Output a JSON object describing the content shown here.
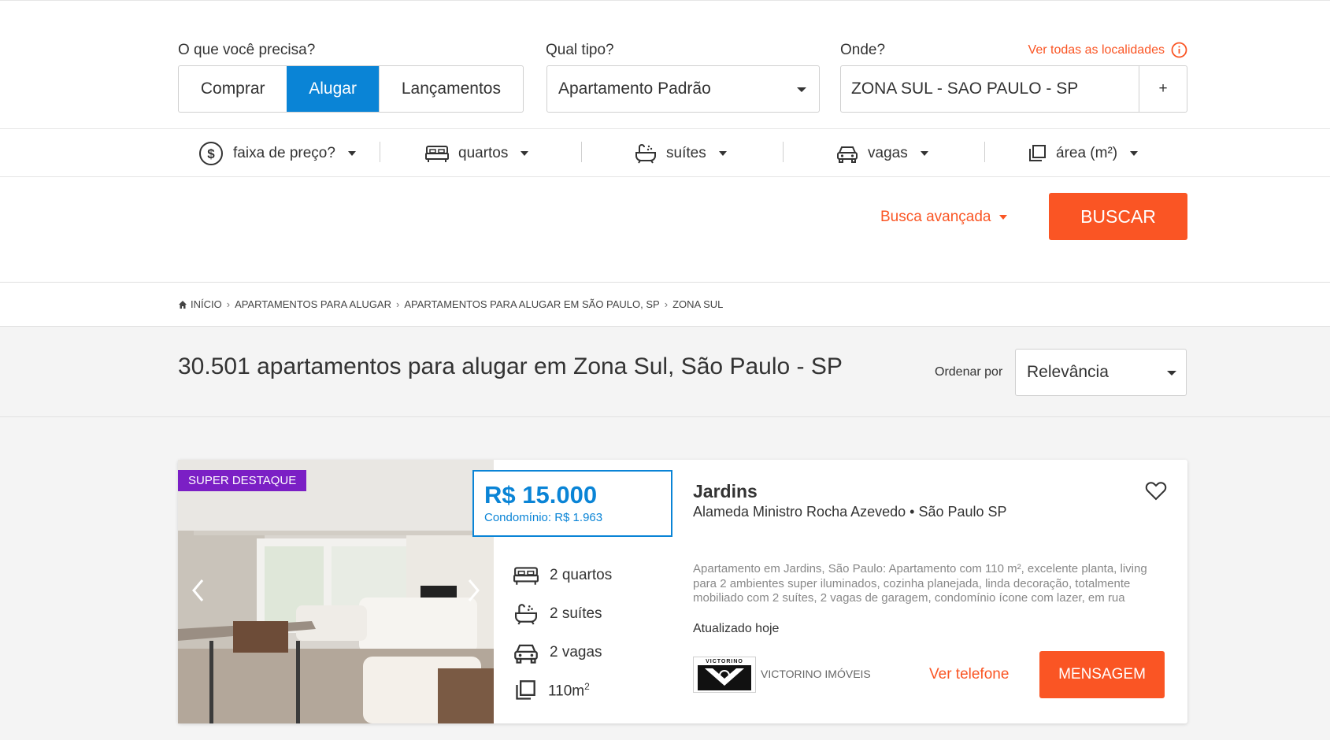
{
  "search": {
    "what_label": "O que você precisa?",
    "type_label": "Qual tipo?",
    "where_label": "Onde?",
    "see_all_locations": "Ver todas as localidades",
    "modes": [
      "Comprar",
      "Alugar",
      "Lançamentos"
    ],
    "active_mode": "Alugar",
    "property_type": "Apartamento Padrão",
    "location": "ZONA SUL - SAO PAULO - SP",
    "add_location": "+"
  },
  "filters": {
    "price": "faixa de preço?",
    "rooms": "quartos",
    "suites": "suítes",
    "parking": "vagas",
    "area": "área (m²)"
  },
  "actions": {
    "advanced": "Busca avançada",
    "search_button": "BUSCAR"
  },
  "breadcrumb": [
    "INÍCIO",
    "APARTAMENTOS PARA ALUGAR",
    "APARTAMENTOS PARA ALUGAR EM SÃO PAULO, SP",
    "ZONA SUL"
  ],
  "results": {
    "title": "30.501 apartamentos para alugar em Zona Sul, São Paulo - SP",
    "sort_label": "Ordenar por",
    "sort_value": "Relevância"
  },
  "listing": {
    "badge": "SUPER DESTAQUE",
    "price": "R$ 15.000",
    "condo": "Condomínio: R$ 1.963",
    "rooms": "2 quartos",
    "suites": "2 suítes",
    "parking": "2 vagas",
    "area": "110m",
    "area_sup": "2",
    "title": "Jardins",
    "address": "Alameda Ministro Rocha Azevedo • São Paulo SP",
    "description": "Apartamento em Jardins, São Paulo: Apartamento com 110 m², excelente planta, living para 2 ambientes super iluminados, cozinha planejada, linda decoração, totalmente mobiliado com 2 suítes, 2 vagas de garagem, condomínio ícone com lazer, em rua",
    "updated": "Atualizado hoje",
    "agency": "VICTORINO IMÓVEIS",
    "agency_logo_text": "VICTORINO",
    "phone_link": "Ver telefone",
    "message_button": "MENSAGEM"
  },
  "colors": {
    "accent_blue": "#0a84d6",
    "accent_orange": "#fa5524",
    "badge_purple": "#7b1fc5"
  },
  "icons": [
    "info-icon",
    "dollar-icon",
    "bed-icon",
    "bathtub-icon",
    "car-icon",
    "area-icon",
    "home-icon",
    "heart-icon",
    "chevron-left-icon",
    "chevron-right-icon"
  ]
}
